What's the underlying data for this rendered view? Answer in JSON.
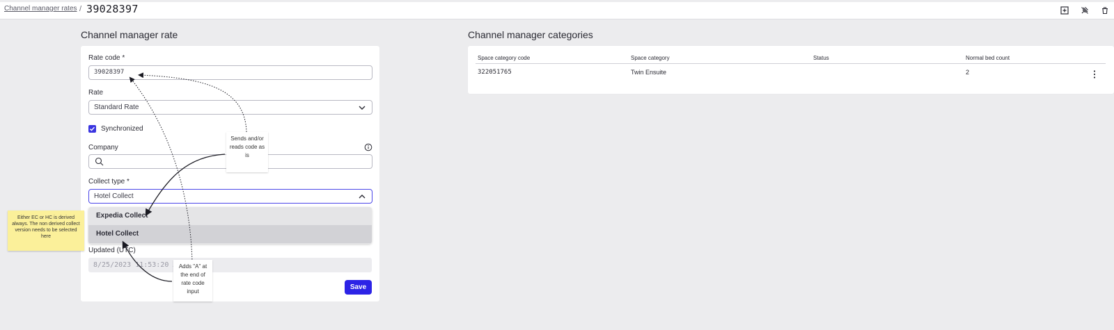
{
  "breadcrumb": {
    "link": "Channel manager rates",
    "separator": "/",
    "current": "39028397"
  },
  "toolbar": {
    "icons": [
      "add-square-icon",
      "unpin-icon",
      "trash-icon"
    ]
  },
  "rate_section": {
    "title": "Channel manager rate",
    "rate_code_label": "Rate code *",
    "rate_code_value": "39028397",
    "rate_label": "Rate",
    "rate_value": "Standard Rate",
    "synchronized_label": "Synchronized",
    "synchronized_checked": true,
    "company_label": "Company",
    "company_value": "",
    "collect_type_label": "Collect type *",
    "collect_type_value": "Hotel Collect",
    "collect_options": [
      "Expedia Collect",
      "Hotel Collect"
    ],
    "updated_label": "Updated (UTC)",
    "updated_value": "8/25/2023 11:53:20 AM",
    "save_label": "Save"
  },
  "categories_section": {
    "title": "Channel manager categories",
    "columns": [
      "Space category code",
      "Space category",
      "Status",
      "Normal bed count"
    ],
    "rows": [
      {
        "code": "322051765",
        "category": "Twin Ensuite",
        "status": "",
        "bed_count": "2"
      }
    ]
  },
  "annotations": {
    "sends_reads": "Sends and/or reads code as is",
    "adds_a": "Adds \"A\" at the end of rate code input",
    "sticky": "Either EC or HC is derived always. The non derived collect version needs to be selected here"
  },
  "colors": {
    "accent": "#2c23e6",
    "sticky": "#fbf09a",
    "background": "#ececee"
  }
}
